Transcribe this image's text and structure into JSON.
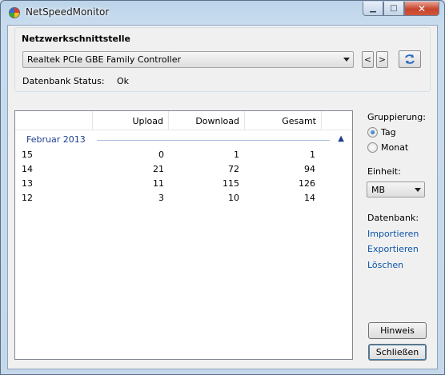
{
  "window": {
    "title": "NetSpeedMonitor"
  },
  "interface_group": {
    "title": "Netzwerkschnittstelle",
    "adapter": "Realtek PCIe GBE Family Controller",
    "prev_label": "<",
    "next_label": ">",
    "db_status_label": "Datenbank Status:",
    "db_status_value": "Ok"
  },
  "table": {
    "columns": [
      "Upload",
      "Download",
      "Gesamt"
    ],
    "group_label": "Februar 2013",
    "rows": [
      {
        "day": "15",
        "upload": "0",
        "download": "1",
        "total": "1"
      },
      {
        "day": "14",
        "upload": "21",
        "download": "72",
        "total": "94"
      },
      {
        "day": "13",
        "upload": "11",
        "download": "115",
        "total": "126"
      },
      {
        "day": "12",
        "upload": "3",
        "download": "10",
        "total": "14"
      }
    ]
  },
  "sidebar": {
    "grouping_label": "Gruppierung:",
    "grouping_options": [
      "Tag",
      "Monat"
    ],
    "grouping_selected": "Tag",
    "unit_label": "Einheit:",
    "unit_value": "MB",
    "db_label": "Datenbank:",
    "links": [
      "Importieren",
      "Exportieren",
      "Löschen"
    ],
    "hint_button": "Hinweis",
    "close_button": "Schließen"
  },
  "colors": {
    "link": "#0f55a8",
    "group_header": "#1e3f8f",
    "title_close": "#c7442c"
  }
}
